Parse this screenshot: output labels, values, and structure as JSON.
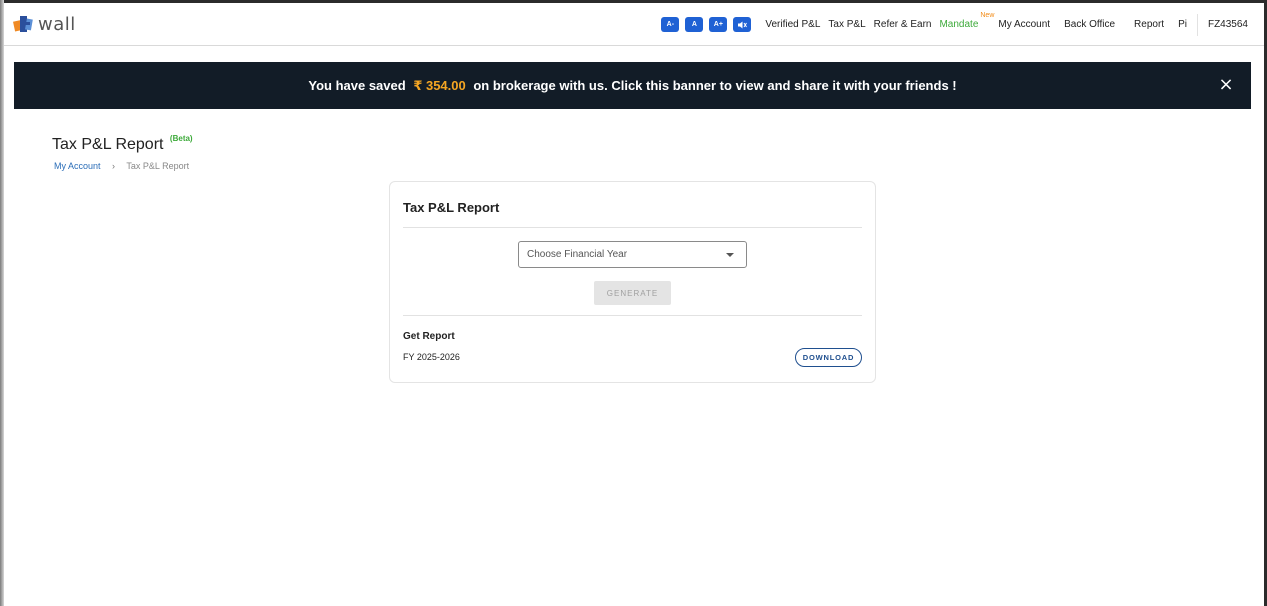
{
  "header": {
    "logo_text": "wall",
    "font_size_buttons": [
      {
        "label": "A-",
        "icon": "font-decrease-icon"
      },
      {
        "label": "A",
        "icon": "font-reset-icon"
      },
      {
        "label": "A+",
        "icon": "font-increase-icon"
      },
      {
        "label": "🔇",
        "icon": "speaker-icon"
      }
    ],
    "nav_items": {
      "verified_pl": "Verified P&L",
      "tax_pl": "Tax P&L",
      "refer_earn": "Refer & Earn",
      "mandate": "Mandate",
      "mandate_badge": "New",
      "my_account": "My Account",
      "back_office": "Back Office",
      "report": "Report",
      "pi": "Pi",
      "user_id": "FZ43564"
    },
    "colors": {
      "accent": "#1f61d4",
      "mandate": "#3daa3a",
      "badge": "#f28c18"
    }
  },
  "banner": {
    "prefix": "You have saved",
    "amount": "₹ 354.00",
    "suffix": "on brokerage with us. Click this banner to view and share it with your friends !",
    "close_label": "×",
    "colors": {
      "background": "#121c27",
      "amount": "#f5a623"
    }
  },
  "page": {
    "title": "Tax P&L Report",
    "beta": "(Beta)",
    "breadcrumb": {
      "parent": "My Account",
      "separator": "›",
      "current": "Tax P&L Report"
    }
  },
  "card": {
    "title": "Tax P&L Report",
    "select_placeholder": "Choose Financial Year",
    "generate_label": "GENERATE",
    "get_report_label": "Get Report",
    "fy_value": "FY 2025-2026",
    "download_label": "DOWNLOAD"
  }
}
